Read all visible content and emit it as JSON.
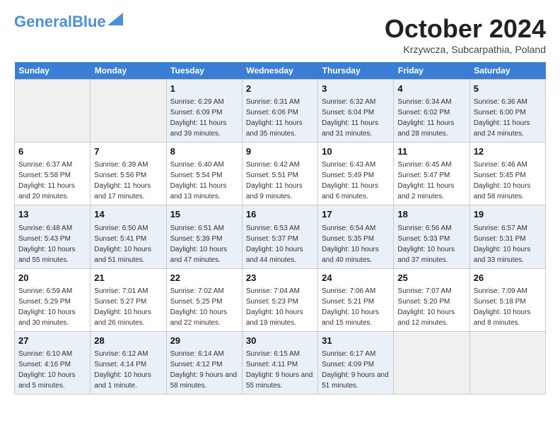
{
  "header": {
    "logo": {
      "part1": "General",
      "part2": "Blue"
    },
    "title": "October 2024",
    "location": "Krzywcza, Subcarpathia, Poland"
  },
  "days_of_week": [
    "Sunday",
    "Monday",
    "Tuesday",
    "Wednesday",
    "Thursday",
    "Friday",
    "Saturday"
  ],
  "weeks": [
    [
      {
        "day": "",
        "sunrise": "",
        "sunset": "",
        "daylight": ""
      },
      {
        "day": "",
        "sunrise": "",
        "sunset": "",
        "daylight": ""
      },
      {
        "day": "1",
        "sunrise": "Sunrise: 6:29 AM",
        "sunset": "Sunset: 6:09 PM",
        "daylight": "Daylight: 11 hours and 39 minutes."
      },
      {
        "day": "2",
        "sunrise": "Sunrise: 6:31 AM",
        "sunset": "Sunset: 6:06 PM",
        "daylight": "Daylight: 11 hours and 35 minutes."
      },
      {
        "day": "3",
        "sunrise": "Sunrise: 6:32 AM",
        "sunset": "Sunset: 6:04 PM",
        "daylight": "Daylight: 11 hours and 31 minutes."
      },
      {
        "day": "4",
        "sunrise": "Sunrise: 6:34 AM",
        "sunset": "Sunset: 6:02 PM",
        "daylight": "Daylight: 11 hours and 28 minutes."
      },
      {
        "day": "5",
        "sunrise": "Sunrise: 6:36 AM",
        "sunset": "Sunset: 6:00 PM",
        "daylight": "Daylight: 11 hours and 24 minutes."
      }
    ],
    [
      {
        "day": "6",
        "sunrise": "Sunrise: 6:37 AM",
        "sunset": "Sunset: 5:58 PM",
        "daylight": "Daylight: 11 hours and 20 minutes."
      },
      {
        "day": "7",
        "sunrise": "Sunrise: 6:39 AM",
        "sunset": "Sunset: 5:56 PM",
        "daylight": "Daylight: 11 hours and 17 minutes."
      },
      {
        "day": "8",
        "sunrise": "Sunrise: 6:40 AM",
        "sunset": "Sunset: 5:54 PM",
        "daylight": "Daylight: 11 hours and 13 minutes."
      },
      {
        "day": "9",
        "sunrise": "Sunrise: 6:42 AM",
        "sunset": "Sunset: 5:51 PM",
        "daylight": "Daylight: 11 hours and 9 minutes."
      },
      {
        "day": "10",
        "sunrise": "Sunrise: 6:43 AM",
        "sunset": "Sunset: 5:49 PM",
        "daylight": "Daylight: 11 hours and 6 minutes."
      },
      {
        "day": "11",
        "sunrise": "Sunrise: 6:45 AM",
        "sunset": "Sunset: 5:47 PM",
        "daylight": "Daylight: 11 hours and 2 minutes."
      },
      {
        "day": "12",
        "sunrise": "Sunrise: 6:46 AM",
        "sunset": "Sunset: 5:45 PM",
        "daylight": "Daylight: 10 hours and 58 minutes."
      }
    ],
    [
      {
        "day": "13",
        "sunrise": "Sunrise: 6:48 AM",
        "sunset": "Sunset: 5:43 PM",
        "daylight": "Daylight: 10 hours and 55 minutes."
      },
      {
        "day": "14",
        "sunrise": "Sunrise: 6:50 AM",
        "sunset": "Sunset: 5:41 PM",
        "daylight": "Daylight: 10 hours and 51 minutes."
      },
      {
        "day": "15",
        "sunrise": "Sunrise: 6:51 AM",
        "sunset": "Sunset: 5:39 PM",
        "daylight": "Daylight: 10 hours and 47 minutes."
      },
      {
        "day": "16",
        "sunrise": "Sunrise: 6:53 AM",
        "sunset": "Sunset: 5:37 PM",
        "daylight": "Daylight: 10 hours and 44 minutes."
      },
      {
        "day": "17",
        "sunrise": "Sunrise: 6:54 AM",
        "sunset": "Sunset: 5:35 PM",
        "daylight": "Daylight: 10 hours and 40 minutes."
      },
      {
        "day": "18",
        "sunrise": "Sunrise: 6:56 AM",
        "sunset": "Sunset: 5:33 PM",
        "daylight": "Daylight: 10 hours and 37 minutes."
      },
      {
        "day": "19",
        "sunrise": "Sunrise: 6:57 AM",
        "sunset": "Sunset: 5:31 PM",
        "daylight": "Daylight: 10 hours and 33 minutes."
      }
    ],
    [
      {
        "day": "20",
        "sunrise": "Sunrise: 6:59 AM",
        "sunset": "Sunset: 5:29 PM",
        "daylight": "Daylight: 10 hours and 30 minutes."
      },
      {
        "day": "21",
        "sunrise": "Sunrise: 7:01 AM",
        "sunset": "Sunset: 5:27 PM",
        "daylight": "Daylight: 10 hours and 26 minutes."
      },
      {
        "day": "22",
        "sunrise": "Sunrise: 7:02 AM",
        "sunset": "Sunset: 5:25 PM",
        "daylight": "Daylight: 10 hours and 22 minutes."
      },
      {
        "day": "23",
        "sunrise": "Sunrise: 7:04 AM",
        "sunset": "Sunset: 5:23 PM",
        "daylight": "Daylight: 10 hours and 19 minutes."
      },
      {
        "day": "24",
        "sunrise": "Sunrise: 7:06 AM",
        "sunset": "Sunset: 5:21 PM",
        "daylight": "Daylight: 10 hours and 15 minutes."
      },
      {
        "day": "25",
        "sunrise": "Sunrise: 7:07 AM",
        "sunset": "Sunset: 5:20 PM",
        "daylight": "Daylight: 10 hours and 12 minutes."
      },
      {
        "day": "26",
        "sunrise": "Sunrise: 7:09 AM",
        "sunset": "Sunset: 5:18 PM",
        "daylight": "Daylight: 10 hours and 8 minutes."
      }
    ],
    [
      {
        "day": "27",
        "sunrise": "Sunrise: 6:10 AM",
        "sunset": "Sunset: 4:16 PM",
        "daylight": "Daylight: 10 hours and 5 minutes."
      },
      {
        "day": "28",
        "sunrise": "Sunrise: 6:12 AM",
        "sunset": "Sunset: 4:14 PM",
        "daylight": "Daylight: 10 hours and 1 minute."
      },
      {
        "day": "29",
        "sunrise": "Sunrise: 6:14 AM",
        "sunset": "Sunset: 4:12 PM",
        "daylight": "Daylight: 9 hours and 58 minutes."
      },
      {
        "day": "30",
        "sunrise": "Sunrise: 6:15 AM",
        "sunset": "Sunset: 4:11 PM",
        "daylight": "Daylight: 9 hours and 55 minutes."
      },
      {
        "day": "31",
        "sunrise": "Sunrise: 6:17 AM",
        "sunset": "Sunset: 4:09 PM",
        "daylight": "Daylight: 9 hours and 51 minutes."
      },
      {
        "day": "",
        "sunrise": "",
        "sunset": "",
        "daylight": ""
      },
      {
        "day": "",
        "sunrise": "",
        "sunset": "",
        "daylight": ""
      }
    ]
  ]
}
